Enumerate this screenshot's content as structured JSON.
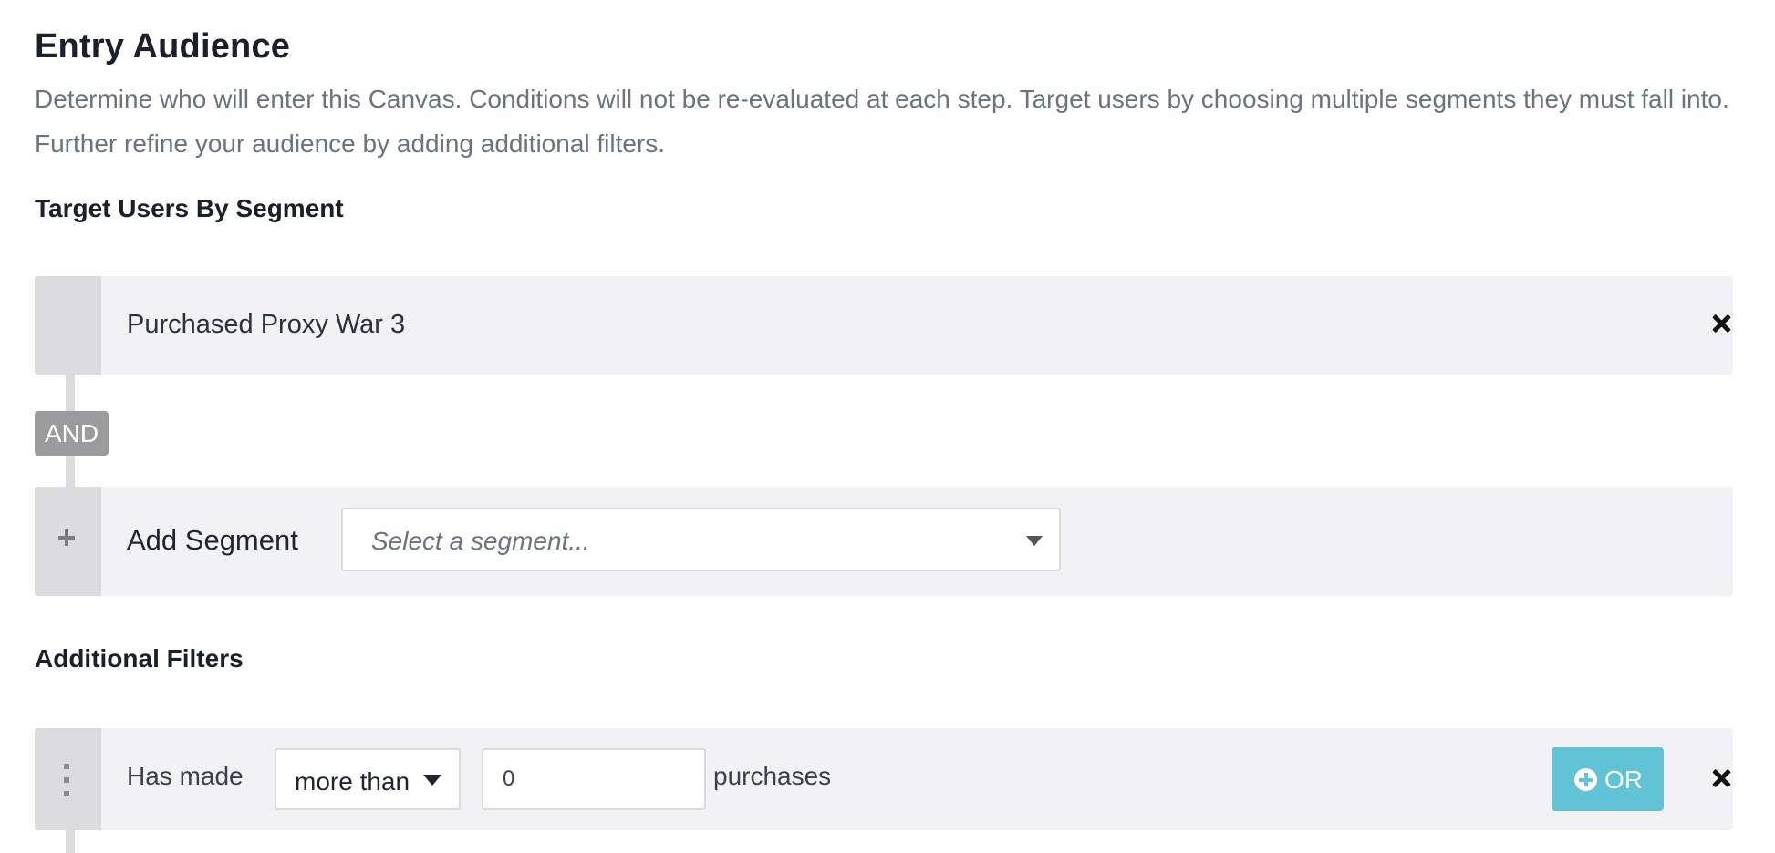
{
  "entry_audience": {
    "title": "Entry Audience",
    "description": "Determine who will enter this Canvas. Conditions will not be re-evaluated at each step. Target users by choosing multiple segments they must fall into. Further refine your audience by adding additional filters."
  },
  "target_segments": {
    "heading": "Target Users By Segment",
    "segments": [
      {
        "label": "Purchased Proxy War 3"
      }
    ],
    "combinator": "AND",
    "add_segment": {
      "label": "Add Segment",
      "placeholder": "Select a segment..."
    }
  },
  "additional_filters": {
    "heading": "Additional Filters",
    "filters": [
      {
        "prefix": "Has made",
        "operator": "more than",
        "value": "0",
        "suffix": "purchases",
        "or_button": "OR"
      }
    ]
  },
  "icons": {
    "remove": "close-icon",
    "add": "plus-icon",
    "drag": "kebab-icon",
    "or": "plus-circle-icon",
    "dropdown": "caret-down-icon"
  },
  "colors": {
    "row_background": "#f2f2f4",
    "row_handle": "#dcdcdf",
    "and_badge": "#9b9b9d",
    "or_button": "#60c3d6",
    "muted_text": "#6b7380"
  }
}
